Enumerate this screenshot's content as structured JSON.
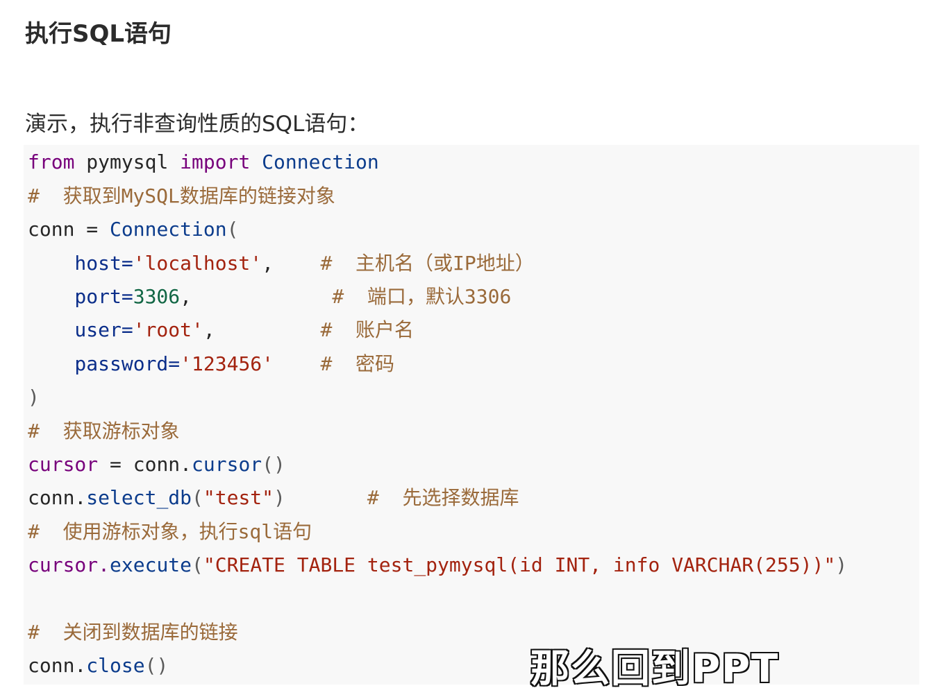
{
  "heading": "执行SQL语句",
  "intro": "演示，执行非查询性质的SQL语句：",
  "code": {
    "l1_kw_from": "from",
    "l1_mod": " pymysql ",
    "l1_kw_import": "import",
    "l1_cls": " Connection",
    "l2_comment": "#  获取到MySQL数据库的链接对象",
    "l3_var": "conn = ",
    "l3_cls": "Connection",
    "l3_paren": "(",
    "l4_param": "    host=",
    "l4_str": "'localhost'",
    "l4_punc": ",    ",
    "l4_comment": "#  主机名（或IP地址）",
    "l5_param": "    port=",
    "l5_num": "3306",
    "l5_punc": ",            ",
    "l5_comment": "#  端口，默认3306",
    "l6_param": "    user=",
    "l6_str": "'root'",
    "l6_punc": ",         ",
    "l6_comment": "#  账户名",
    "l7_param": "    password=",
    "l7_str": "'123456'",
    "l7_space": "    ",
    "l7_comment": "#  密码",
    "l8_close": ")",
    "l9_comment": "#  获取游标对象",
    "l10_var": "cursor",
    "l10_eq": " = conn.",
    "l10_method": "cursor",
    "l10_paren": "()",
    "l11_obj": "conn.",
    "l11_method": "select_db",
    "l11_open": "(",
    "l11_str": "\"test\"",
    "l11_close": ")",
    "l11_space": "       ",
    "l11_comment": "#  先选择数据库",
    "l12_comment": "#  使用游标对象，执行sql语句",
    "l13_obj": "cursor.",
    "l13_method": "execute",
    "l13_open": "(",
    "l13_str": "\"CREATE TABLE test_pymysql(id INT, info VARCHAR(255))\"",
    "l13_close": ")",
    "l15_comment": "#  关闭到数据库的链接",
    "l16_obj": "conn.",
    "l16_method": "close",
    "l16_paren": "()"
  },
  "subtitle": "那么回到PPT"
}
